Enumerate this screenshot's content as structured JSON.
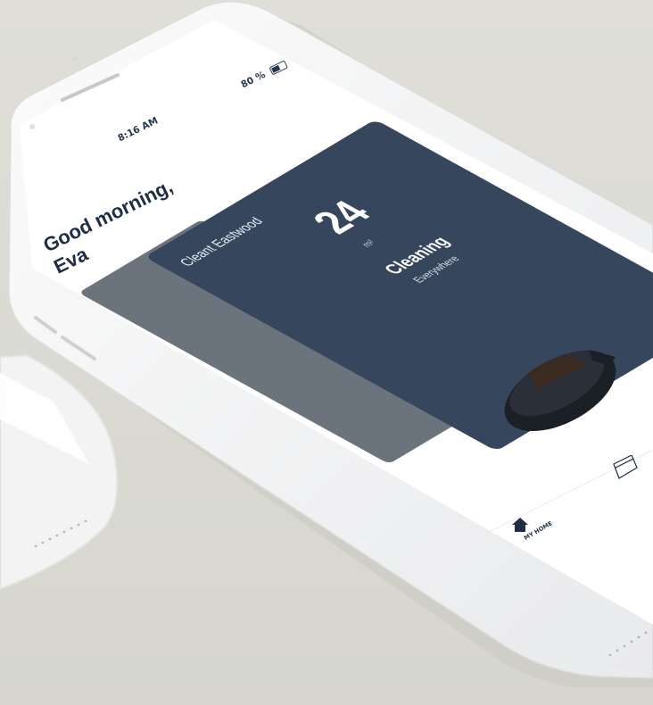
{
  "status_bar": {
    "time": "8:16 AM",
    "battery": "80 %"
  },
  "greeting": {
    "line1": "Good morning,",
    "line2": "Eva"
  },
  "robot_card": {
    "title": "Cleant Eastwood",
    "area_value": "24",
    "area_unit": "m²",
    "status": "Cleaning",
    "substatus": "Everywhere"
  },
  "tab_bar": {
    "home_label": "MY HOME",
    "home_icon": "house-icon",
    "second_icon": "window-icon"
  },
  "colors": {
    "background": "#dcdcd4",
    "card": "#36465d",
    "card_secondary": "#6b737d",
    "text_dark": "#1f2e45",
    "screen": "#ffffff"
  }
}
